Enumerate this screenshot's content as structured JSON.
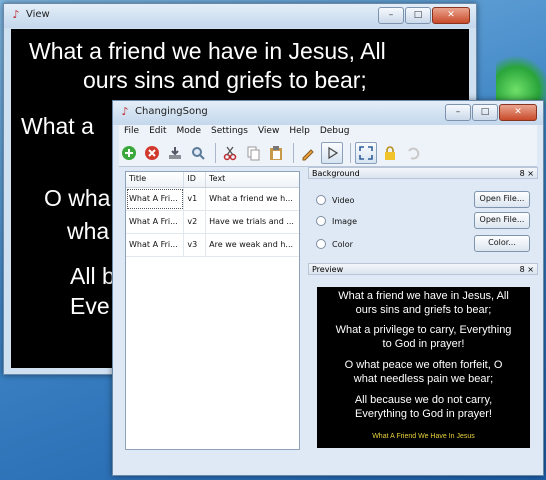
{
  "view_window": {
    "title": "View",
    "lines": [
      "What a friend we have in Jesus, All",
      "ours sins and griefs to bear;",
      "What a",
      "O wha",
      "wha",
      "All b",
      "Eve"
    ]
  },
  "app": {
    "title": "ChangingSong",
    "menu": [
      "File",
      "Edit",
      "Mode",
      "Settings",
      "View",
      "Help",
      "Debug"
    ],
    "toolbar_icons": [
      "add-icon",
      "remove-icon",
      "import-icon",
      "search-icon",
      "cut-icon",
      "copy-icon",
      "paste-icon",
      "edit-icon",
      "play-icon",
      "fullscreen-icon",
      "lock-icon",
      "undo-icon"
    ],
    "table": {
      "headers": [
        "Title",
        "ID",
        "Text"
      ],
      "rows": [
        [
          "What A Fri...",
          "v1",
          "What a friend we h..."
        ],
        [
          "What A Fri...",
          "v2",
          "Have we trials and ..."
        ],
        [
          "What A Fri...",
          "v3",
          "Are we weak and h..."
        ]
      ]
    },
    "background_panel": {
      "title": "Background",
      "controls": "8 ×",
      "options": [
        {
          "label": "Video",
          "button": "Open File..."
        },
        {
          "label": "Image",
          "button": "Open File..."
        },
        {
          "label": "Color",
          "button": "Color..."
        }
      ]
    },
    "preview_panel": {
      "title": "Preview",
      "controls": "8 ×",
      "lines": [
        "What a friend we have in Jesus, All",
        "ours sins and griefs to bear;",
        "What a privilege to carry, Everything",
        "to God in prayer!",
        "O what peace we often forfeit, O",
        "what needless pain we bear;",
        "All because we do not carry,",
        "Everything to God in prayer!"
      ],
      "song_title": "What A Friend We Have In Jesus"
    }
  },
  "window_buttons": {
    "min": "–",
    "max": "□",
    "close": "✕"
  },
  "colors": {
    "accent_yellow": "#e8d23a",
    "lyrics_bg": "#000000",
    "lyrics_fg": "#ffffff"
  }
}
